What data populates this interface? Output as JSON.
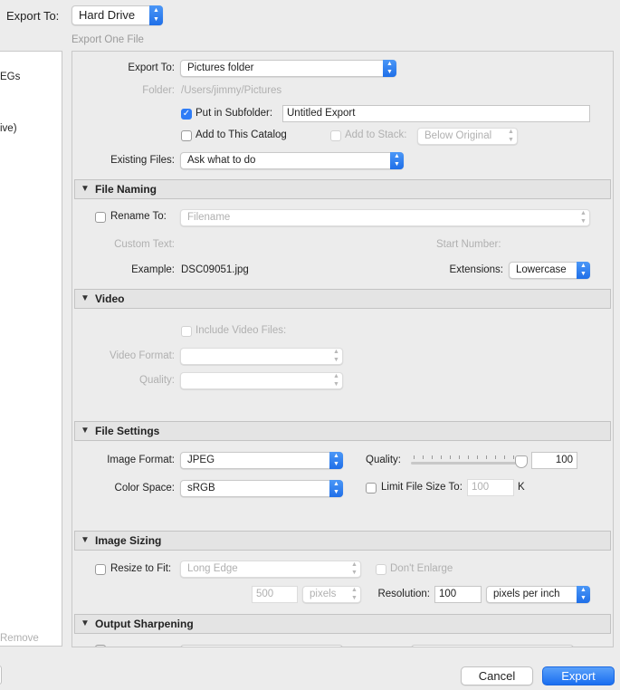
{
  "top": {
    "export_to_label": "Export To:",
    "export_to_value": "Hard Drive",
    "subtitle": "Export One File"
  },
  "left_panel": {
    "item1": "EGs",
    "item2": "ive)",
    "remove": "Remove"
  },
  "export_location": {
    "export_to_label": "Export To:",
    "export_to_value": "Pictures folder",
    "folder_label": "Folder:",
    "folder_value": "/Users/jimmy/Pictures",
    "subfolder_label": "Put in Subfolder:",
    "subfolder_value": "Untitled Export",
    "add_catalog_label": "Add to This Catalog",
    "add_stack_label": "Add to Stack:",
    "add_stack_value": "Below Original",
    "existing_label": "Existing Files:",
    "existing_value": "Ask what to do"
  },
  "file_naming": {
    "title": "File Naming",
    "rename_label": "Rename To:",
    "rename_value": "Filename",
    "custom_text_label": "Custom Text:",
    "start_number_label": "Start Number:",
    "example_label": "Example:",
    "example_value": "DSC09051.jpg",
    "extensions_label": "Extensions:",
    "extensions_value": "Lowercase"
  },
  "video": {
    "title": "Video",
    "include_label": "Include Video Files:",
    "format_label": "Video Format:",
    "quality_label": "Quality:"
  },
  "file_settings": {
    "title": "File Settings",
    "image_format_label": "Image Format:",
    "image_format_value": "JPEG",
    "quality_label": "Quality:",
    "quality_value": "100",
    "color_space_label": "Color Space:",
    "color_space_value": "sRGB",
    "limit_label": "Limit File Size To:",
    "limit_value": "100",
    "limit_unit": "K"
  },
  "image_sizing": {
    "title": "Image Sizing",
    "resize_label": "Resize to Fit:",
    "resize_value": "Long Edge",
    "dont_enlarge_label": "Don't Enlarge",
    "size_value": "500",
    "size_unit": "pixels",
    "resolution_label": "Resolution:",
    "resolution_value": "100",
    "resolution_unit": "pixels per inch"
  },
  "output_sharpening": {
    "title": "Output Sharpening"
  },
  "footer": {
    "cancel": "Cancel",
    "export": "Export"
  },
  "colors": {
    "accent": "#2f7cf6",
    "panel_bg": "#ececec"
  }
}
